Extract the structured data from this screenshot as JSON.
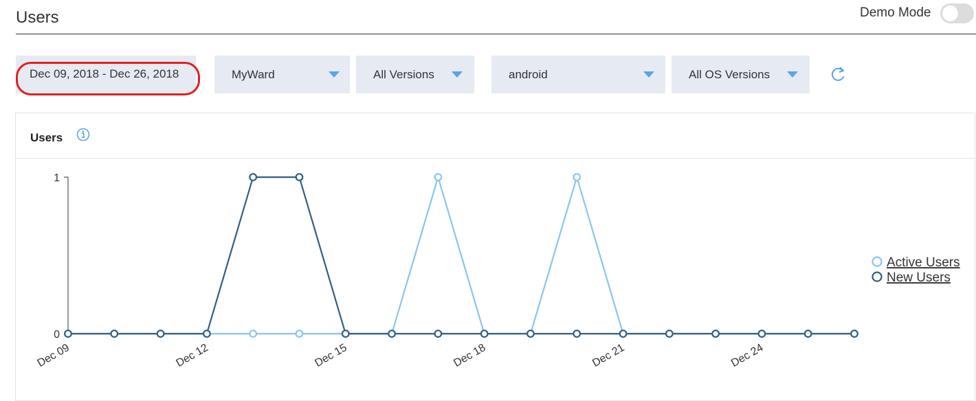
{
  "header": {
    "title": "Users",
    "demo_mode_label": "Demo Mode",
    "demo_mode_on": false
  },
  "filters": {
    "date_range": "Dec 09, 2018 - Dec 26, 2018",
    "app": "MyWard",
    "version": "All Versions",
    "platform": "android",
    "os_version": "All OS Versions"
  },
  "card": {
    "title": "Users"
  },
  "colors": {
    "active_users": "#86c5f0",
    "new_users": "#2e5d87",
    "accent": "#5ba4e6",
    "highlight": "#e02020"
  },
  "chart_data": {
    "type": "line",
    "x": [
      "Dec 09",
      "Dec 10",
      "Dec 11",
      "Dec 12",
      "Dec 13",
      "Dec 14",
      "Dec 15",
      "Dec 16",
      "Dec 17",
      "Dec 18",
      "Dec 19",
      "Dec 20",
      "Dec 21",
      "Dec 22",
      "Dec 23",
      "Dec 24",
      "Dec 25",
      "Dec 26"
    ],
    "x_tick_labels": [
      "Dec 09",
      "Dec 12",
      "Dec 15",
      "Dec 18",
      "Dec 21",
      "Dec 24"
    ],
    "y_tick_labels": [
      "0",
      "1"
    ],
    "ylim": [
      0,
      1
    ],
    "series": [
      {
        "name": "Active Users",
        "values": [
          0,
          0,
          0,
          0,
          0,
          0,
          0,
          0,
          1,
          0,
          0,
          1,
          0,
          0,
          0,
          0,
          0,
          0
        ]
      },
      {
        "name": "New Users",
        "values": [
          0,
          0,
          0,
          0,
          1,
          1,
          0,
          0,
          0,
          0,
          0,
          0,
          0,
          0,
          0,
          0,
          0,
          0
        ]
      }
    ],
    "legend": "right"
  }
}
